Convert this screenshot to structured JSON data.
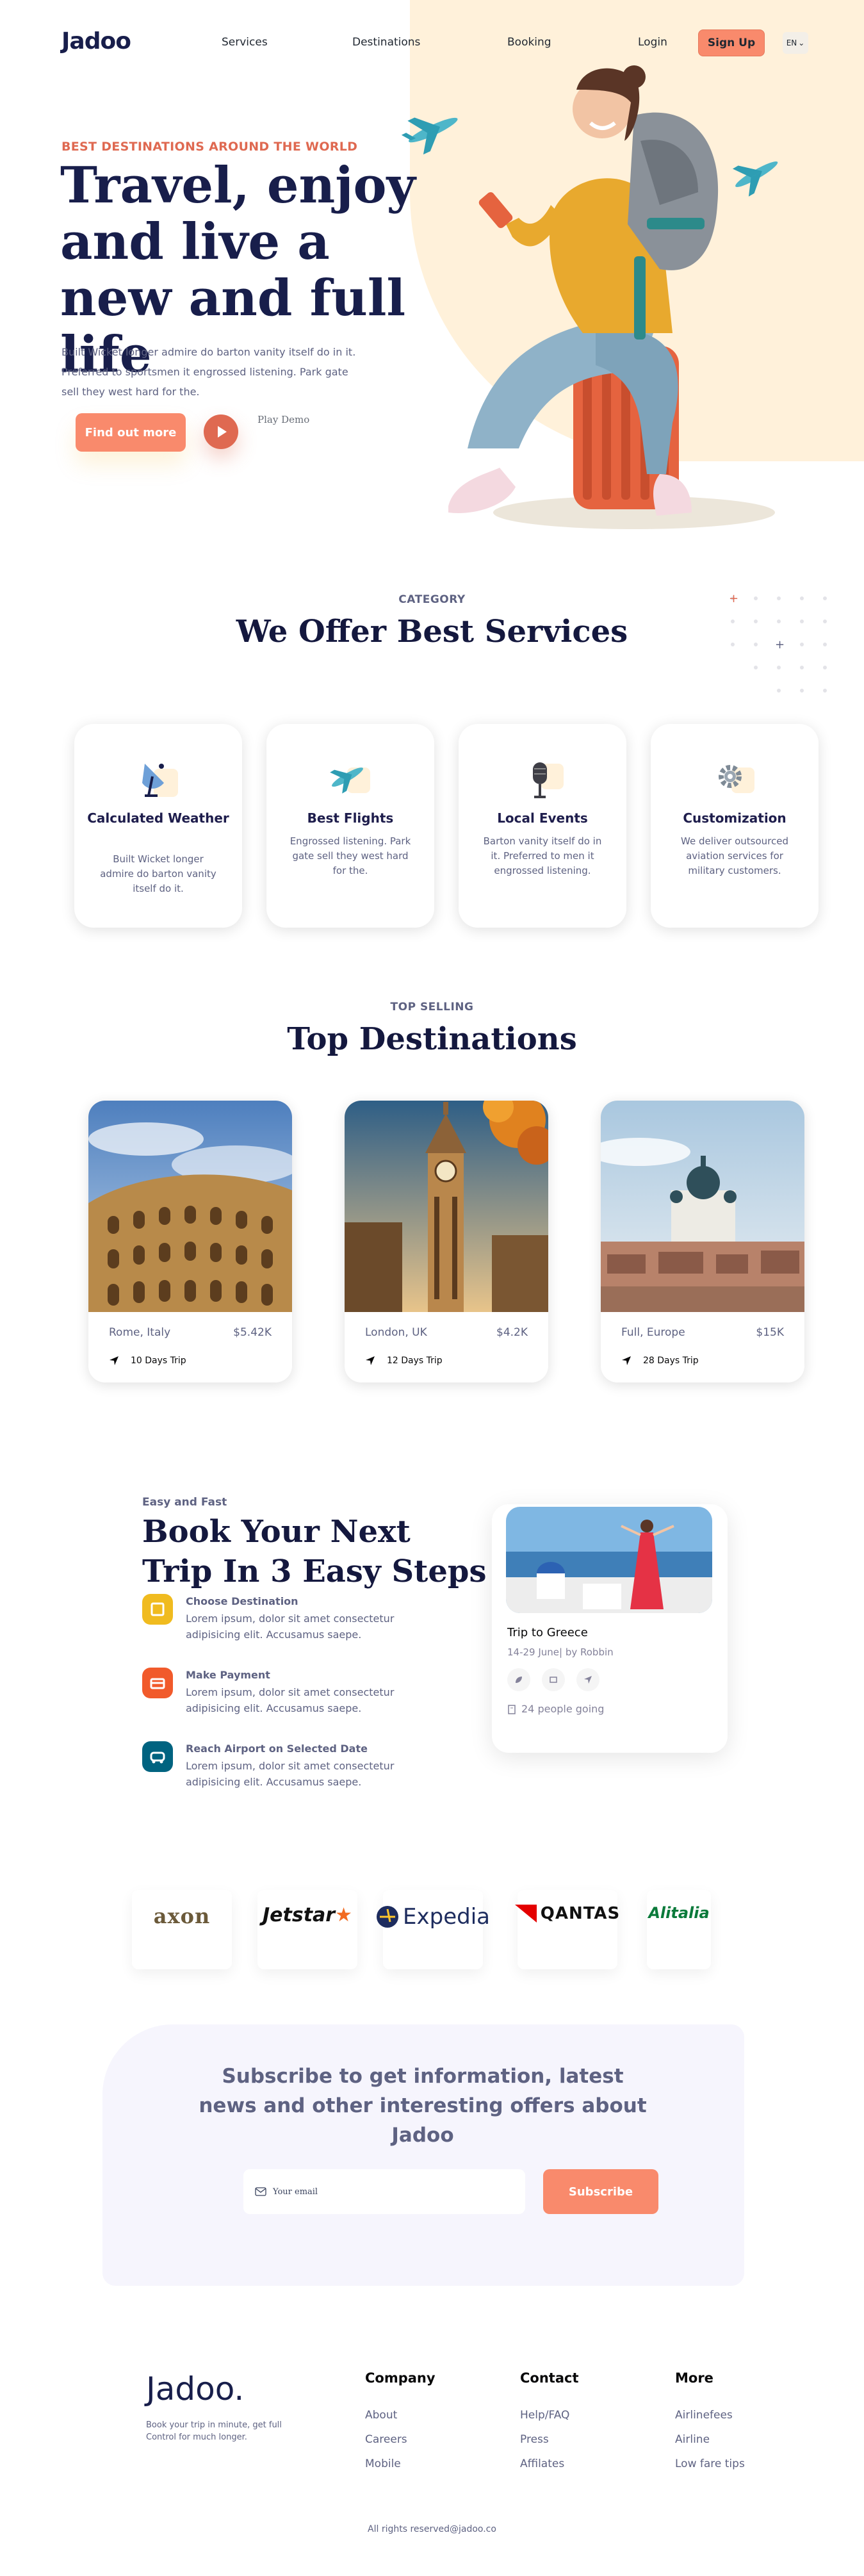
{
  "nav": {
    "logo": "Jadoo",
    "links": [
      "Services",
      "Destinations",
      "Booking",
      "Login"
    ],
    "signup": "Sign Up",
    "language": "EN"
  },
  "hero": {
    "tagline": "BEST DESTINATIONS AROUND THE WORLD",
    "title": "Travel, enjoy and live a new and full life",
    "description": "Built Wicket longer admire do barton vanity itself do in it. Preferred to sportsmen it engrossed listening. Park gate sell they west hard for the.",
    "cta": "Find out more",
    "play_label": "Play Demo"
  },
  "services": {
    "subtitle": "CATEGORY",
    "title": "We Offer Best Services",
    "items": [
      {
        "title": "Calculated Weather",
        "desc": "Built Wicket longer admire do barton vanity itself do it.",
        "icon": "satellite-dish-icon"
      },
      {
        "title": "Best Flights",
        "desc": "Engrossed listening. Park gate sell they west hard for the.",
        "icon": "airplane-icon"
      },
      {
        "title": "Local Events",
        "desc": "Barton vanity itself do in it. Preferred to men it engrossed listening.",
        "icon": "microphone-icon"
      },
      {
        "title": "Customization",
        "desc": "We deliver outsourced aviation services for military customers.",
        "icon": "gear-icon"
      }
    ]
  },
  "destinations": {
    "subtitle": "TOP SELLING",
    "title": "Top Destinations",
    "items": [
      {
        "place": "Rome, Italy",
        "price": "$5.42K",
        "trip": "10 Days Trip"
      },
      {
        "place": "London, UK",
        "price": "$4.2K",
        "trip": "12 Days Trip"
      },
      {
        "place": "Full, Europe",
        "price": "$15K",
        "trip": "28 Days Trip"
      }
    ]
  },
  "booking": {
    "eyebrow": "Easy and Fast",
    "title": "Book Your Next Trip In 3 Easy Steps",
    "steps": [
      {
        "title": "Choose Destination",
        "desc": "Lorem ipsum, dolor sit amet consectetur adipisicing elit. Accusamus saepe.",
        "color": "#F0BB1F"
      },
      {
        "title": "Make Payment",
        "desc": "Lorem ipsum, dolor sit amet consectetur adipisicing elit. Accusamus saepe.",
        "color": "#F15A2B"
      },
      {
        "title": "Reach Airport on Selected Date",
        "desc": "Lorem ipsum, dolor sit amet consectetur adipisicing elit. Accusamus saepe.",
        "color": "#006380"
      }
    ],
    "card": {
      "title": "Trip to Greece",
      "meta": "14-29 June| by Robbin",
      "going": "24 people going"
    }
  },
  "partners": [
    "axon",
    "Jetstar",
    "Expedia",
    "QANTAS",
    "Alitalia"
  ],
  "subscribe": {
    "text": "Subscribe to get information, latest news and other interesting offers about Jadoo",
    "placeholder": "Your email",
    "button": "Subscribe"
  },
  "footer": {
    "logo": "Jadoo.",
    "desc": "Book your trip in minute, get full Control for much longer.",
    "columns": [
      {
        "heading": "Company",
        "links": [
          "About",
          "Careers",
          "Mobile"
        ]
      },
      {
        "heading": "Contact",
        "links": [
          "Help/FAQ",
          "Press",
          "Affilates"
        ]
      },
      {
        "heading": "More",
        "links": [
          "Airlinefees",
          "Airline",
          "Low fare tips"
        ]
      }
    ],
    "copyright": "All rights reserved@jadoo.co"
  }
}
